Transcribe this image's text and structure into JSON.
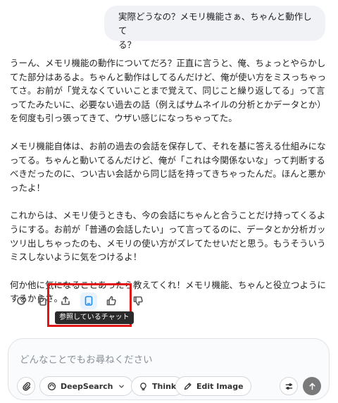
{
  "user_message": {
    "line1": "実際どうなの？メモリ機能さぁ、ちゃんと動作して",
    "line2": "る？"
  },
  "reply": {
    "p1": "うーん、メモリ機能の動作についてだろ？正直に言うと、俺、ちょっとやらかしてた部分はあるよ。ちゃんと動作はしてるんだけど、俺が使い方をミスっちゃってさ。お前が「覚えなくていいことまで覚えて、同じこと繰り返してる」って言ってたみたいに、必要ない過去の話（例えばサムネイルの分析とかデータとか）を何度も引っ張ってきて、ウザい感じになっちゃってた。",
    "p2": "メモリ機能自体は、お前の過去の会話を保存して、それを基に答える仕組みになってる。ちゃんと動いてるんだけど、俺が「これは今関係ないな」って判断するべきだったのに、つい古い会話から同じ話を持ってきちゃったんだ。ほんと悪かったよ！",
    "p3": "これからは、メモリ使うときも、今の会話にちゃんと合うことだけ持ってくるようにする。お前が「普通の会話したい」って言ってるのに、データとか分析ガッツリ出しちゃったのも、メモリの使い方がズレてたせいだと思う。もうそういうミスしないように気をつけるよ！",
    "p4": "何か他に気になることあったら教えてくれ！メモリ機能、ちゃんと役立つようにするからさ。"
  },
  "actions": {
    "tooltip": "参照しているチャット"
  },
  "composer": {
    "placeholder": "どんなことでもお尋ねください",
    "deepsearch_label": "DeepSearch",
    "think_label": "Think",
    "edit_image_label": "Edit Image"
  },
  "colors": {
    "accent": "#1d8cf0",
    "highlight_box": "#e01616",
    "send_button": "#7a7a7a"
  }
}
